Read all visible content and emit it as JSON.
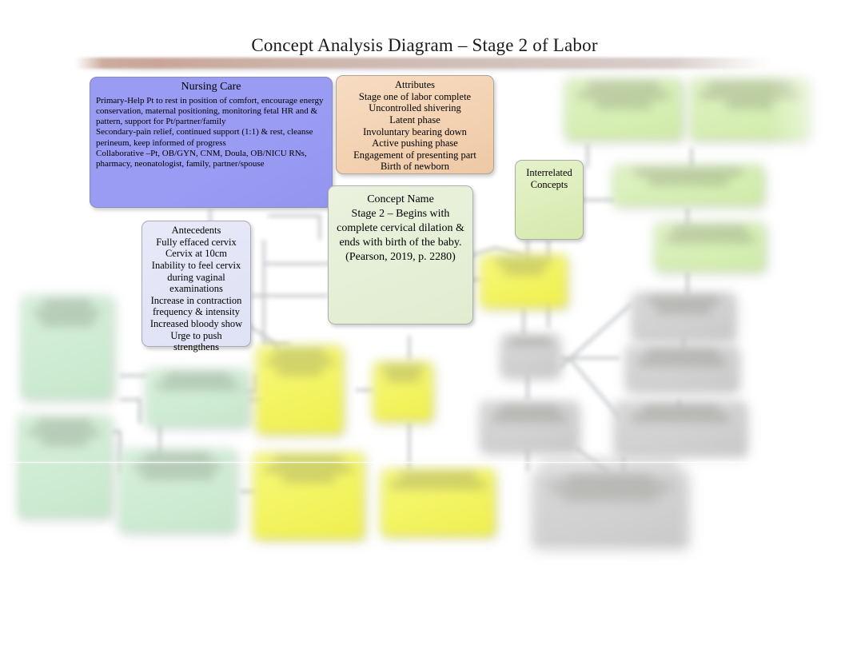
{
  "document": {
    "title": "Concept Analysis Diagram – Stage 2 of Labor"
  },
  "diagram": {
    "type": "concept-analysis-map",
    "nursing_care": {
      "heading": "Nursing Care",
      "lines": [
        "Primary-Help Pt to rest in position of comfort, encourage energy conservation, maternal positioning, monitoring fetal HR and & pattern, support for Pt/partner/family",
        "Secondary-pain relief, continued support (1:1) & rest, cleanse perineum, keep informed of progress",
        "Collaborative –Pt, OB/GYN, CNM, Doula, OB/NICU RNs, pharmacy, neonatologist, family, partner/spouse"
      ]
    },
    "attributes": {
      "heading": "Attributes",
      "lines": [
        "Stage one of labor complete",
        "Uncontrolled shivering",
        "Latent phase",
        "Involuntary bearing down",
        "Active pushing phase",
        "Engagement of presenting part",
        "Birth of newborn"
      ]
    },
    "concept_name": {
      "heading": "Concept Name",
      "lines": [
        "Stage 2 – Begins with",
        "complete cervical dilation &",
        "ends with birth of the baby.",
        "(Pearson, 2019, p. 2280)"
      ]
    },
    "antecedents": {
      "heading": "Antecedents",
      "lines": [
        "Fully effaced cervix",
        "Cervix at 10cm",
        "Inability to feel cervix",
        "during vaginal",
        "examinations",
        "Increase in contraction",
        "frequency & intensity",
        "Increased bloody show",
        "Urge to push strengthens"
      ]
    },
    "interrelated_concepts": {
      "heading_line_1": "Interrelated",
      "heading_line_2": "Concepts"
    },
    "obscured_nodes": [
      {
        "id": "n1",
        "color_group": "light-green",
        "legible": false
      },
      {
        "id": "n2",
        "color_group": "light-green",
        "legible": false
      },
      {
        "id": "n3",
        "color_group": "light-green",
        "legible": false
      },
      {
        "id": "n4",
        "color_group": "light-green",
        "legible": false
      },
      {
        "id": "n5",
        "color_group": "green",
        "legible": false
      },
      {
        "id": "n6",
        "color_group": "green",
        "legible": false
      },
      {
        "id": "n7",
        "color_group": "green",
        "legible": false
      },
      {
        "id": "n8",
        "color_group": "green",
        "legible": false
      },
      {
        "id": "n9",
        "color_group": "yellow",
        "legible": false
      },
      {
        "id": "n10",
        "color_group": "yellow",
        "legible": false
      },
      {
        "id": "n11",
        "color_group": "yellow",
        "legible": false
      },
      {
        "id": "n12",
        "color_group": "yellow",
        "legible": false
      },
      {
        "id": "n13",
        "color_group": "yellow",
        "legible": false
      },
      {
        "id": "n14",
        "color_group": "gray",
        "legible": false
      },
      {
        "id": "n15",
        "color_group": "gray",
        "legible": false
      },
      {
        "id": "n16",
        "color_group": "gray",
        "legible": false
      },
      {
        "id": "n17",
        "color_group": "gray",
        "legible": false
      },
      {
        "id": "n18",
        "color_group": "gray",
        "legible": false
      },
      {
        "id": "n19",
        "color_group": "gray",
        "legible": false
      },
      {
        "id": "n20",
        "color_group": "gray",
        "legible": false
      }
    ]
  },
  "colors": {
    "nursing_care_fill": "#9a9cf4",
    "attributes_fill": "#f3d2b2",
    "concept_name_fill": "#e5efd6",
    "antecedents_fill": "#e2e4f6",
    "interrelated_fill": "#dcedb9",
    "green_fill": "#cdebd2",
    "light_green_fill": "#d5eeb2",
    "yellow_fill": "#f3f35e",
    "gray_fill": "#d0d0d0",
    "banner_start": "#c7a294",
    "banner_end": "#d8cdc9",
    "page_background": "#ffffff",
    "text": "#1a1a1a"
  }
}
